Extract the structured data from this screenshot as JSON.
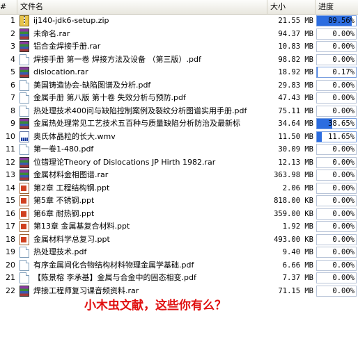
{
  "header": {
    "num_label": "#",
    "name_label": "文件名",
    "size_label": "大小",
    "progress_label": "进度"
  },
  "files": [
    {
      "num": "1",
      "name": "ij140-jdk6-setup.zip",
      "icon": "zip-icon",
      "size": "21.55 MB",
      "progress": "89.56%",
      "fill": 0.8956
    },
    {
      "num": "2",
      "name": "未命名.rar",
      "icon": "rar-icon",
      "size": "94.37 MB",
      "progress": "0.00%",
      "fill": 0
    },
    {
      "num": "3",
      "name": "铝合金焊接手册.rar",
      "icon": "rar-icon",
      "size": "10.83 MB",
      "progress": "0.00%",
      "fill": 0
    },
    {
      "num": "4",
      "name": "焊接手册 第一卷 焊接方法及设备 （第三版）.pdf",
      "icon": "pdf-icon",
      "size": "98.82 MB",
      "progress": "0.00%",
      "fill": 0
    },
    {
      "num": "5",
      "name": "dislocation.rar",
      "icon": "rar-icon",
      "size": "18.92 MB",
      "progress": "0.17%",
      "fill": 0.0017
    },
    {
      "num": "6",
      "name": "美国铸造协会-缺陷图谱及分析.pdf",
      "icon": "pdf-icon",
      "size": "29.83 MB",
      "progress": "0.00%",
      "fill": 0
    },
    {
      "num": "7",
      "name": "金属手册 第八版 第十卷 失效分析与预防.pdf",
      "icon": "pdf-icon",
      "size": "47.43 MB",
      "progress": "0.00%",
      "fill": 0
    },
    {
      "num": "8",
      "name": "热处理技术400问与缺陷控制案例及裂纹分析图谱实用手册.pdf",
      "icon": "pdf-icon",
      "size": "75.11 MB",
      "progress": "0.00%",
      "fill": 0
    },
    {
      "num": "9",
      "name": "金属热处理常见工艺技术五百种与质量缺陷分析防治及最新标",
      "icon": "rar-icon",
      "size": "34.64 MB",
      "progress": "38.65%",
      "fill": 0.3865
    },
    {
      "num": "10",
      "name": "奥氏体晶粒的长大.wmv",
      "icon": "video-icon",
      "size": "11.50 MB",
      "progress": "11.65%",
      "fill": 0.1165
    },
    {
      "num": "11",
      "name": " 第一卷1-480.pdf",
      "icon": "pdf-icon",
      "size": "30.09 MB",
      "progress": "0.00%",
      "fill": 0
    },
    {
      "num": "12",
      "name": "位错理论Theory of Dislocations JP Hirth 1982.rar",
      "icon": "rar-icon",
      "size": "12.13 MB",
      "progress": "0.00%",
      "fill": 0
    },
    {
      "num": "13",
      "name": "金属材料金相图谱.rar",
      "icon": "rar-icon",
      "size": "363.98 MB",
      "progress": "0.00%",
      "fill": 0
    },
    {
      "num": "14",
      "name": "第2章 工程结构钢.ppt",
      "icon": "ppt-icon",
      "size": "2.06 MB",
      "progress": "0.00%",
      "fill": 0
    },
    {
      "num": "15",
      "name": "第5章 不锈钢.ppt",
      "icon": "ppt-icon",
      "size": "818.00 KB",
      "progress": "0.00%",
      "fill": 0
    },
    {
      "num": "16",
      "name": "第6章 耐热钢.ppt",
      "icon": "ppt-icon",
      "size": "359.00 KB",
      "progress": "0.00%",
      "fill": 0
    },
    {
      "num": "17",
      "name": "第13章 金属基复合材料.ppt",
      "icon": "ppt-icon",
      "size": "1.92 MB",
      "progress": "0.00%",
      "fill": 0
    },
    {
      "num": "18",
      "name": "金属材料学总复习.ppt",
      "icon": "ppt-icon",
      "size": "493.00 KB",
      "progress": "0.00%",
      "fill": 0
    },
    {
      "num": "19",
      "name": "热处理技术.pdf",
      "icon": "pdf-icon",
      "size": "9.40 MB",
      "progress": "0.00%",
      "fill": 0
    },
    {
      "num": "20",
      "name": "有序金属间化合物结构材料物理金属学基础.pdf",
      "icon": "pdf-icon",
      "size": "6.66 MB",
      "progress": "0.00%",
      "fill": 0
    },
    {
      "num": "21",
      "name": "【陈景榕 李承基】金属与合金中的固态相变.pdf",
      "icon": "pdf-icon",
      "size": "7.37 MB",
      "progress": "0.00%",
      "fill": 0
    },
    {
      "num": "22",
      "name": "焊接工程师复习课音频资料.rar",
      "icon": "rar-icon",
      "size": "71.15 MB",
      "progress": "0.00%",
      "fill": 0
    }
  ],
  "caption": "小木虫文献，这些你有么？",
  "colors": {
    "progress_fill": "#2c6de0",
    "caption": "#e01010"
  }
}
